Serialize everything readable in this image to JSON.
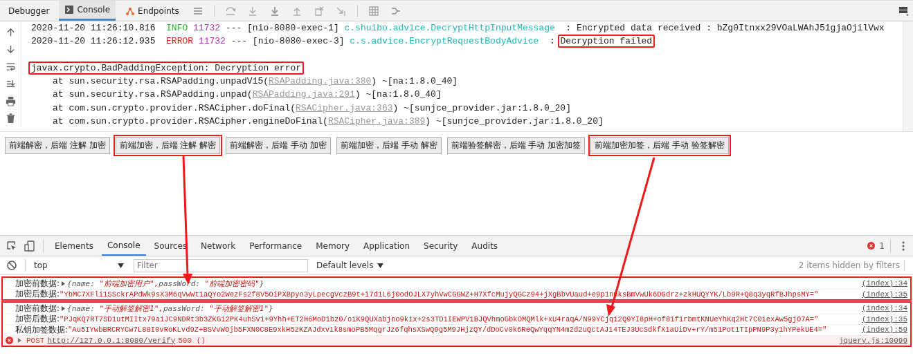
{
  "ide": {
    "tabs": [
      {
        "label": "Debugger",
        "selected": false
      },
      {
        "label": "Console",
        "selected": true
      },
      {
        "label": "Endpoints",
        "selected": false
      }
    ],
    "log_lines": [
      {
        "timestamp": "2020-11-20 11:26:10.816",
        "level": "INFO",
        "pid": "11732",
        "separator": "---",
        "thread": "[nio-8080-exec-1]",
        "logger": "c.shuibo.advice.DecryptHttpInputMessage",
        "colon": ":",
        "message": "Encrypted data received : bZg0Itnxx29VOaLWAhJ51gjaOjilVwx",
        "highlighted": false
      },
      {
        "timestamp": "2020-11-20 11:26:12.935",
        "level": "ERROR",
        "pid": "11732",
        "separator": "---",
        "thread": "[nio-8080-exec-3]",
        "logger": "c.s.advice.EncryptRequestBodyAdvice",
        "colon": ":",
        "message": "Decryption failed",
        "highlighted": true
      }
    ],
    "exception": {
      "text": "javax.crypto.BadPaddingException: Decryption error",
      "highlighted": true
    },
    "stack": [
      {
        "prefix": "at sun.security.rsa.RSAPadding.unpadV15(",
        "link": "RSAPadding.java:380",
        "suffix": ") ~[na:1.8.0_40]"
      },
      {
        "prefix": "at sun.security.rsa.RSAPadding.unpad(",
        "link": "RSAPadding.java:291",
        "suffix": ") ~[na:1.8.0_40]"
      },
      {
        "prefix": "at com.sun.crypto.provider.RSACipher.doFinal(",
        "link": "RSACipher.java:363",
        "suffix": ") ~[sunjce_provider.jar:1.8.0_20]"
      },
      {
        "prefix": "at com.sun.crypto.provider.RSACipher.engineDoFinal(",
        "link": "RSACipher.java:389",
        "suffix": ") ~[sunjce_provider.jar:1.8.0_20]"
      }
    ]
  },
  "buttons": [
    {
      "label": "前端解密，后端 注解 加密",
      "highlighted": false
    },
    {
      "label": "前端加密，后端 注解 解密",
      "highlighted": true
    },
    {
      "label": "前端解密，后端 手动 加密",
      "highlighted": false
    },
    {
      "label": "前端加密，后端 手动 解密",
      "highlighted": false
    },
    {
      "label": "前端验签解密，后端 手动 加密加签",
      "highlighted": false
    },
    {
      "label": "前端加密加签，后端 手动 验签解密",
      "highlighted": true
    }
  ],
  "devtools": {
    "tabs": [
      {
        "label": "Elements",
        "selected": false
      },
      {
        "label": "Console",
        "selected": true
      },
      {
        "label": "Sources",
        "selected": false
      },
      {
        "label": "Network",
        "selected": false
      },
      {
        "label": "Performance",
        "selected": false
      },
      {
        "label": "Memory",
        "selected": false
      },
      {
        "label": "Application",
        "selected": false
      },
      {
        "label": "Security",
        "selected": false
      },
      {
        "label": "Audits",
        "selected": false
      }
    ],
    "error_count": "1",
    "context": "top",
    "filter": {
      "placeholder": "Filter"
    },
    "levels": "Default levels",
    "hidden_note": "2 items hidden by filters",
    "groups": [
      {
        "highlighted": true,
        "entries": [
          {
            "kind": "object",
            "label": "加密前数据:",
            "open": "{",
            "close": "}",
            "props": [
              {
                "key": "name:",
                "value": "\"前端加密用户\","
              },
              {
                "key": "passWord:",
                "value": "\"前端加密密码\""
              }
            ],
            "source": "(index):34"
          },
          {
            "kind": "string",
            "label": "加密后数据:",
            "value": "\"YbMC7XFli1SSckrAPdWk9sX3M6qVwWt1aQYo2WezFs2f8V5OiPXBpyo3yLpecgVczB9t+i7d1L6j0odOJLX7yhVwCGGWZ+H7XfcMujyQGCz94+jXgBbVUaud+e9p1nnksBmVwUk6DGdrz+zkHUQYYK/Lb9R+Q8q3yqRfBJhpsMY=\"",
            "source": "(index):35"
          }
        ]
      },
      {
        "highlighted": true,
        "entries": [
          {
            "kind": "object",
            "label": "加密前数据:",
            "open": "{",
            "close": "}",
            "props": [
              {
                "key": "name:",
                "value": "\"手动解签解密1\","
              },
              {
                "key": "passWord:",
                "value": "\"手动解签解密1\""
              }
            ],
            "source": "(index):34"
          },
          {
            "kind": "string",
            "label": "加密后数据:",
            "value": "\"PJqKQ7RT7SD1utMIItx79aiJC9NDRt3b3ZKG12PK4uhSv1+9Yhh+ET2H6MoD1bz0/oiK9QUXabjno9kix+2s3TD1IEWPV1BJQVhmoGbkOMQMlk+xU4raqA/N99YCjq12Q9YI8pH+of81f1rbmtKNUeYhKq2Ht7C0iexAw5gjO7A=\"",
            "source": "(index):35"
          },
          {
            "kind": "string",
            "label": "私钥加签数据:",
            "value": "\"Au5IYwbBRCRYCw7L88I0vRoKLvd9Z+BSVvWOjb5FXN0C8E9xkH5zKZAJdxv1k8smoPB5MqgrJz6fqhsXSwQ9g5M9JHjzQY/dDoCv0k6ReQwYqqYN4m2d2uQctAJ14TEJ3UcSdkfX1aUiDv+rY/m51Pot1TIpPN9P3y1hYPekUE4=\"",
            "source": "(index):59"
          },
          {
            "kind": "error",
            "method": "POST",
            "url": "http://127.0.0.1:8080/verify",
            "status": "500 ()",
            "source": "jquery.js:10099"
          }
        ]
      }
    ]
  }
}
